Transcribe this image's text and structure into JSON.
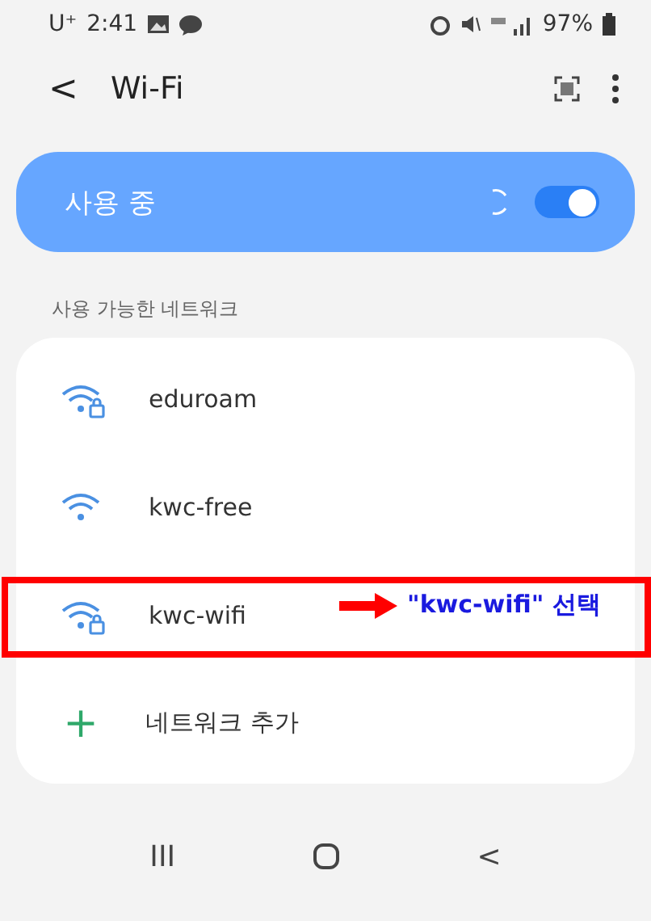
{
  "status_bar": {
    "carrier": "U⁺",
    "time": "2:41",
    "battery": "97%"
  },
  "header": {
    "back": "<",
    "title": "Wi-Fi"
  },
  "master_switch": {
    "label": "사용 중",
    "on": true
  },
  "section_label": "사용 가능한 네트워크",
  "networks": [
    {
      "name": "eduroam",
      "kind": "locked",
      "highlighted": false
    },
    {
      "name": "kwc-free",
      "kind": "open",
      "highlighted": false
    },
    {
      "name": "kwc-wifi",
      "kind": "locked",
      "highlighted": true
    }
  ],
  "add_network": {
    "icon": "+",
    "label": "네트워크 추가"
  },
  "annotation": {
    "text": "\"kwc-wifi\" 선택"
  },
  "nav_bar": {
    "recent": "III",
    "back": "<"
  }
}
